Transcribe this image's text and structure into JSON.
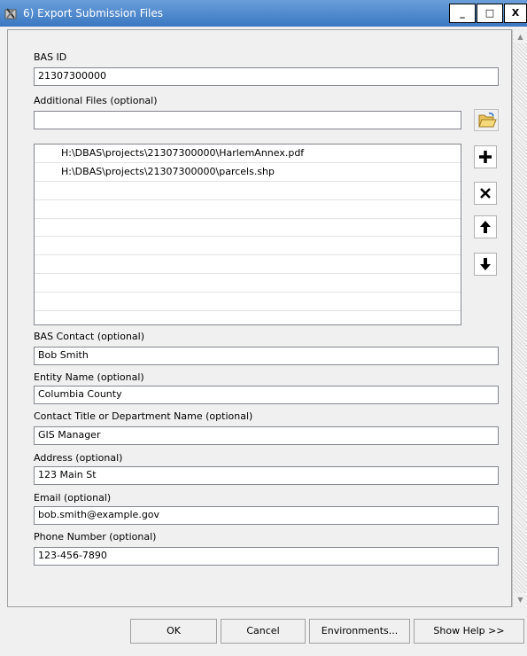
{
  "window": {
    "title": "6) Export Submission Files",
    "controls": {
      "minimize": "_",
      "maximize": "□",
      "close": "X"
    }
  },
  "form": {
    "bas_id": {
      "label": "BAS ID",
      "value": "21307300000"
    },
    "additional_files": {
      "label": "Additional Files (optional)",
      "value": "",
      "items": [
        "H:\\DBAS\\projects\\21307300000\\HarlemAnnex.pdf",
        "H:\\DBAS\\projects\\21307300000\\parcels.shp"
      ]
    },
    "bas_contact": {
      "label": "BAS Contact (optional)",
      "value": "Bob Smith"
    },
    "entity_name": {
      "label": "Entity Name (optional)",
      "value": "Columbia County"
    },
    "contact_title": {
      "label": "Contact Title or Department Name (optional)",
      "value": "GIS Manager"
    },
    "address": {
      "label": "Address (optional)",
      "value": "123 Main St"
    },
    "email": {
      "label": "Email (optional)",
      "value": "bob.smith@example.gov"
    },
    "phone": {
      "label": "Phone Number (optional)",
      "value": "123-456-7890"
    }
  },
  "icons": {
    "app": "toolbox-icon",
    "browse": "open-folder-icon",
    "add": "plus-icon",
    "remove": "x-icon",
    "move_up": "arrow-up-icon",
    "move_down": "arrow-down-icon"
  },
  "buttons": {
    "ok": "OK",
    "cancel": "Cancel",
    "environments": "Environments...",
    "show_help": "Show Help >>"
  }
}
